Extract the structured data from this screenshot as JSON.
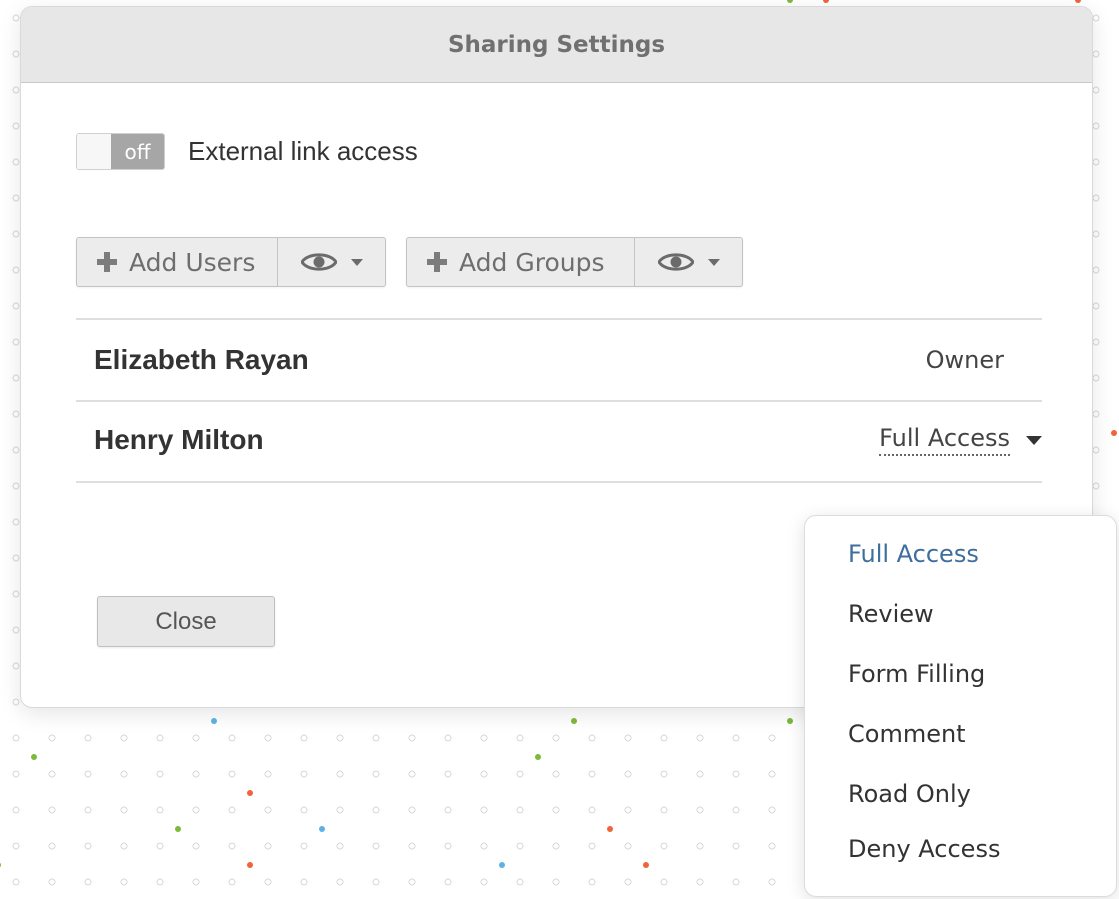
{
  "dialog": {
    "title": "Sharing Settings"
  },
  "external_link": {
    "toggle_state": "off",
    "label": "External link access"
  },
  "buttons": {
    "add_users": "Add Users",
    "add_groups": "Add Groups",
    "close": "Close"
  },
  "icons": {
    "add": "plus-icon",
    "visibility": "eye-icon",
    "dropdown": "caret-down-icon"
  },
  "users": [
    {
      "name": "Elizabeth Rayan",
      "role": "Owner"
    },
    {
      "name": "Henry Milton",
      "role": "Full Access"
    }
  ],
  "access_menu": {
    "selected": "Full Access",
    "options": [
      "Full Access",
      "Review",
      "Form Filling",
      "Comment",
      "Road Only",
      "Deny Access"
    ]
  },
  "colors": {
    "header_bg": "#e7e7e7",
    "active_option": "#3d6e9c",
    "dot_green": "#7cbb3a",
    "dot_orange": "#f0643a",
    "dot_blue": "#5cb3e3",
    "dot_gray": "#d6d6d6"
  }
}
